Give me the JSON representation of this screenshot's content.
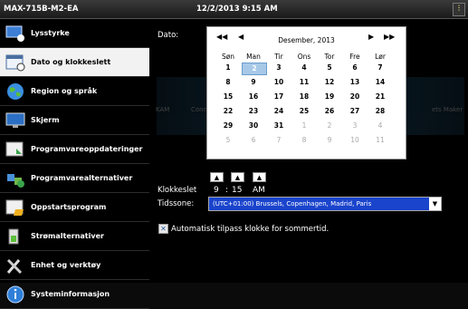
{
  "titlebar": {
    "device": "MAX-715B-M2-EA",
    "datetime": "12/2/2013 9:15 AM",
    "tray_icon": "toolbar-icon"
  },
  "sidebar": {
    "items": [
      {
        "label": "Lysstyrke",
        "icon": "brightness-icon"
      },
      {
        "label": "Dato og klokkeslett",
        "icon": "calendar-clock-icon",
        "active": true
      },
      {
        "label": "Region og språk",
        "icon": "globe-icon"
      },
      {
        "label": "Skjerm",
        "icon": "monitor-icon"
      },
      {
        "label": "Programvareoppdateringer",
        "icon": "software-update-icon"
      },
      {
        "label": "Programvarealternativer",
        "icon": "puzzle-icon"
      },
      {
        "label": "Oppstartsprogram",
        "icon": "startup-folder-icon"
      },
      {
        "label": "Strømalternativer",
        "icon": "power-icon"
      },
      {
        "label": "Enhet og verktøy",
        "icon": "tools-icon"
      },
      {
        "label": "Systeminformasjon",
        "icon": "info-icon"
      }
    ]
  },
  "background_ghost": {
    "left_text": "KAM",
    "mid_text": "Connecting",
    "right_text": "ets Maker"
  },
  "date": {
    "label": "Dato:",
    "month_title": "Desember, 2013",
    "nav": {
      "prev_year": "◀◀",
      "prev_month": "◀",
      "next_month": "▶",
      "next_year": "▶▶"
    },
    "weekdays": [
      "Søn",
      "Man",
      "Tir",
      "Ons",
      "Tor",
      "Fre",
      "Lør"
    ],
    "weeks": [
      [
        "1",
        "2",
        "3",
        "4",
        "5",
        "6",
        "7"
      ],
      [
        "8",
        "9",
        "10",
        "11",
        "12",
        "13",
        "14"
      ],
      [
        "15",
        "16",
        "17",
        "18",
        "19",
        "20",
        "21"
      ],
      [
        "22",
        "23",
        "24",
        "25",
        "26",
        "27",
        "28"
      ],
      [
        "29",
        "30",
        "31",
        "1",
        "2",
        "3",
        "4"
      ],
      [
        "5",
        "6",
        "7",
        "8",
        "9",
        "10",
        "11"
      ]
    ],
    "selected": "2"
  },
  "time": {
    "label": "Klokkeslet",
    "hour": "9",
    "separator": ":",
    "minute": "15",
    "ampm": "AM",
    "up": "▲",
    "down": "▼"
  },
  "timezone": {
    "label": "Tidssone:",
    "value": "(UTC+01:00) Brussels, Copenhagen, Madrid, Paris",
    "arrow": "▼"
  },
  "dst": {
    "label": "Automatisk tilpass klokke for sommertid.",
    "checked": true,
    "mark": "✕"
  }
}
